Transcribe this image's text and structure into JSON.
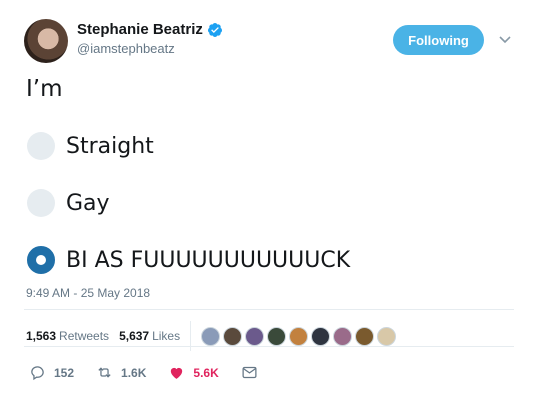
{
  "user": {
    "display_name": "Stephanie Beatriz",
    "handle": "@iamstephbeatz",
    "verified": true,
    "follow_label": "Following"
  },
  "tweet": {
    "text": "I’m",
    "poll": {
      "options": [
        {
          "label": "Straight",
          "selected": false
        },
        {
          "label": "Gay",
          "selected": false
        },
        {
          "label": "BI AS FUUUUUUUUUUUCK",
          "selected": true
        }
      ]
    },
    "timestamp": "9:49 AM - 25 May 2018"
  },
  "stats": {
    "retweets_count": "1,563",
    "retweets_label": "Retweets",
    "likes_count": "5,637",
    "likes_label": "Likes",
    "liker_avatar_colors": [
      "#8a9bb8",
      "#5a4a3c",
      "#6b5a8c",
      "#3a4a3a",
      "#c2813f",
      "#2e3440",
      "#9a6b8a",
      "#7a5a2e",
      "#d8c8a8"
    ]
  },
  "actions": {
    "reply_count": "152",
    "retweet_count": "1.6K",
    "like_count": "5.6K"
  },
  "colors": {
    "accent": "#1da1f2",
    "like": "#e0245e",
    "radio_selected": "#1f6fa8"
  }
}
